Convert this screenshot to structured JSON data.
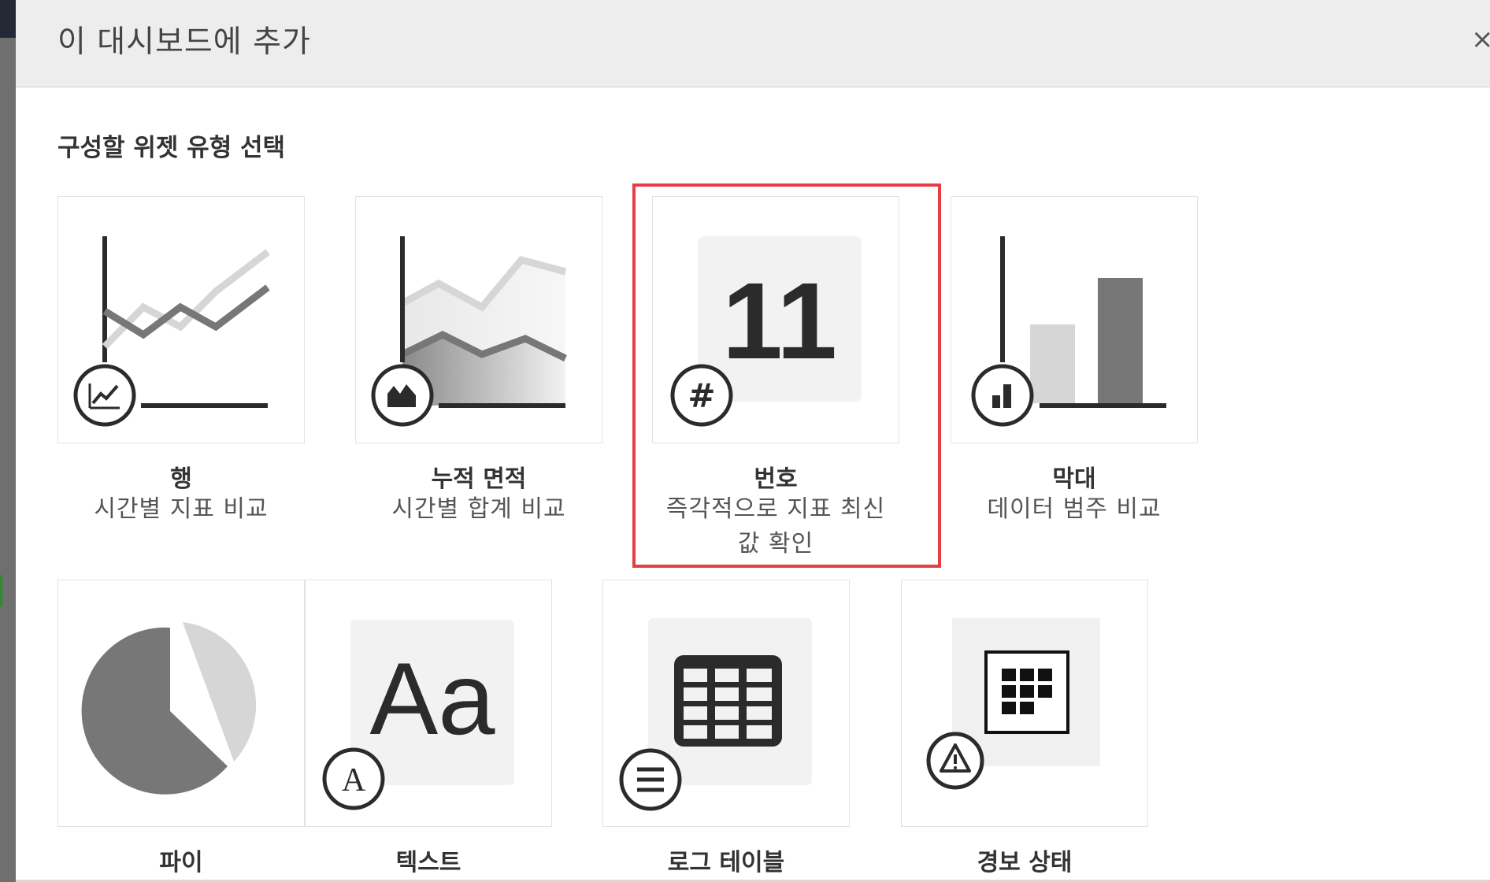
{
  "dialog": {
    "title": "이 대시보드에 추가",
    "close_glyph": "×"
  },
  "section": {
    "title": "구성할 위젯 유형 선택"
  },
  "widgets": [
    {
      "name": "행",
      "description": "시간별 지표 비교",
      "icon": "line-chart-icon"
    },
    {
      "name": "누적 면적",
      "description": "시간별 합계 비교",
      "icon": "stacked-area-icon"
    },
    {
      "name": "번호",
      "description": "즉각적으로 지표 최신 값 확인",
      "preview_value": "11",
      "icon": "hash-icon",
      "selected": true
    },
    {
      "name": "막대",
      "description": "데이터 범주 비교",
      "icon": "bar-chart-icon"
    },
    {
      "name": "파이",
      "icon": "pie-chart-icon"
    },
    {
      "name": "텍스트",
      "preview_value": "Aa",
      "icon": "text-icon"
    },
    {
      "name": "로그 테이블",
      "icon": "log-table-icon"
    },
    {
      "name": "경보 상태",
      "icon": "alarm-status-icon"
    }
  ],
  "colors": {
    "selection_border": "#e53e44",
    "icon_dark": "#2b2b2b",
    "series_dark": "#777777",
    "series_light": "#d6d6d6"
  }
}
